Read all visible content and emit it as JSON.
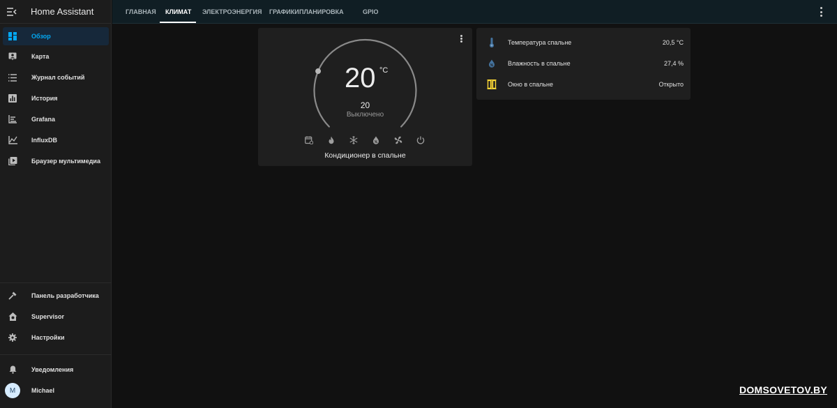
{
  "app": {
    "title": "Home Assistant"
  },
  "sidebar": {
    "items": [
      {
        "label": "Обзор",
        "icon": "dashboard-icon",
        "active": true
      },
      {
        "label": "Карта",
        "icon": "map-icon"
      },
      {
        "label": "Журнал событий",
        "icon": "logbook-icon"
      },
      {
        "label": "История",
        "icon": "history-icon"
      },
      {
        "label": "Grafana",
        "icon": "grafana-icon"
      },
      {
        "label": "InfluxDB",
        "icon": "influxdb-icon"
      },
      {
        "label": "Браузер мультимедиа",
        "icon": "media-browser-icon"
      }
    ],
    "bottom_items": [
      {
        "label": "Панель разработчика",
        "icon": "hammer-icon"
      },
      {
        "label": "Supervisor",
        "icon": "supervisor-icon"
      },
      {
        "label": "Настройки",
        "icon": "gear-icon"
      }
    ],
    "notifications_label": "Уведомления",
    "user": {
      "name": "Michael",
      "initial": "M"
    }
  },
  "tabs": [
    {
      "label": "ГЛАВНАЯ"
    },
    {
      "label": "КЛИМАТ",
      "active": true
    },
    {
      "label": "ЭЛЕКТРОЭНЕРГИЯ"
    },
    {
      "label": "ГРАФИКИ"
    },
    {
      "label": "ПЛАНИРОВКА"
    },
    {
      "label": "GPIO"
    }
  ],
  "thermostat": {
    "current_temp": "20",
    "unit": "°C",
    "target": "20",
    "state": "Выключено",
    "name": "Кондиционер в спальне",
    "setpoint_fraction": 0.25,
    "modes": [
      "calendar-clock-icon",
      "fire-icon",
      "snowflake-icon",
      "water-percent-icon",
      "fan-icon",
      "power-icon"
    ]
  },
  "entities": [
    {
      "name": "Температура спальне",
      "value": "20,5 °C",
      "icon": "thermometer-icon"
    },
    {
      "name": "Влажность в спальне",
      "value": "27,4 %",
      "icon": "water-percent-icon"
    },
    {
      "name": "Окно в спальне",
      "value": "Открыто",
      "icon": "window-open-icon"
    }
  ],
  "colors": {
    "accent": "#03a9f4",
    "window_icon": "#fdd835",
    "thermo_icon": "#44739e"
  },
  "watermark": "DOMSOVETOV.BY"
}
